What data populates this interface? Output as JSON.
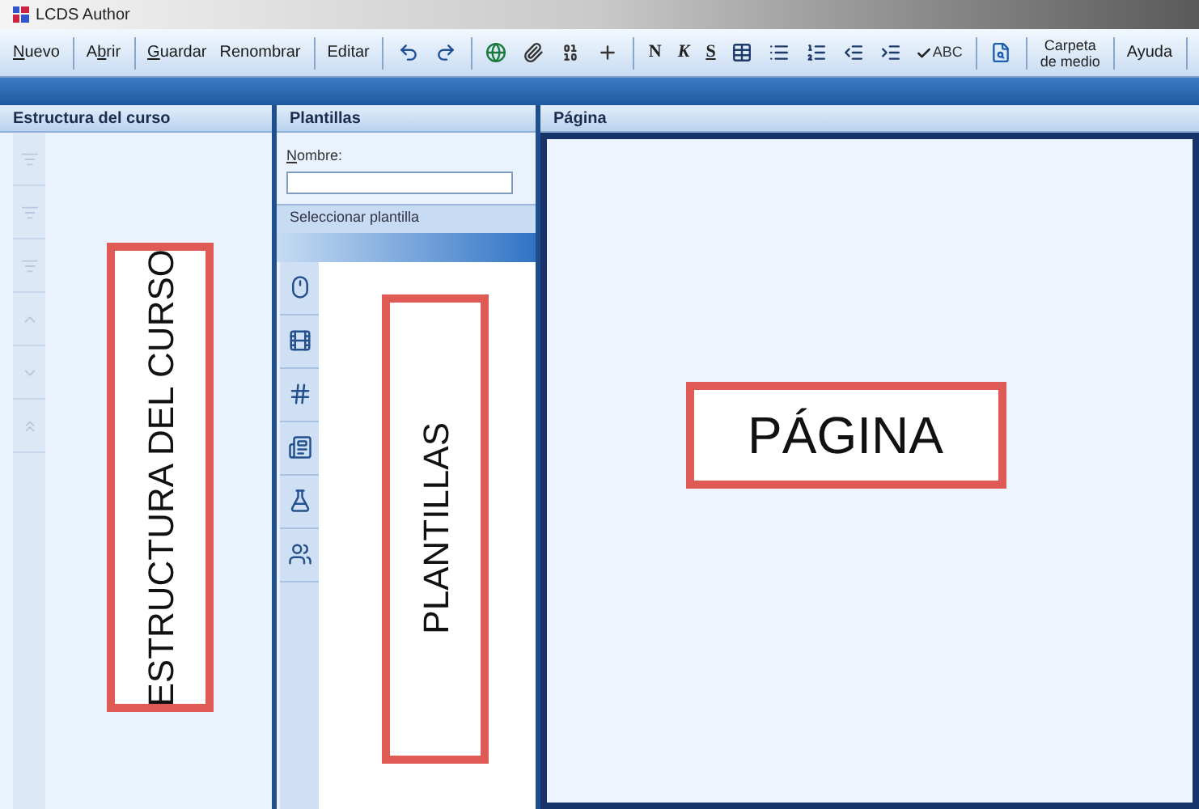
{
  "window": {
    "title": "LCDS Author"
  },
  "toolbar": [
    {
      "kind": "text",
      "key": "N",
      "post": "uevo"
    },
    {
      "kind": "sep"
    },
    {
      "kind": "text",
      "pre": "A",
      "key": "b",
      "post": "rir"
    },
    {
      "kind": "sep"
    },
    {
      "kind": "text",
      "key": "G",
      "post": "uardar"
    },
    {
      "kind": "text",
      "pre": "Renombrar"
    },
    {
      "kind": "sep"
    },
    {
      "kind": "text",
      "pre": "Editar"
    },
    {
      "kind": "sep"
    },
    {
      "kind": "undo"
    },
    {
      "kind": "redo"
    },
    {
      "kind": "sep"
    },
    {
      "kind": "globe"
    },
    {
      "kind": "clip"
    },
    {
      "kind": "binary"
    },
    {
      "kind": "plus"
    },
    {
      "kind": "sep"
    },
    {
      "kind": "bold",
      "label": "N"
    },
    {
      "kind": "italic",
      "label": "K"
    },
    {
      "kind": "underline",
      "label": "S"
    },
    {
      "kind": "table"
    },
    {
      "kind": "list"
    },
    {
      "kind": "numbered"
    },
    {
      "kind": "outdent"
    },
    {
      "kind": "indent"
    },
    {
      "kind": "spell",
      "label": "ABC"
    },
    {
      "kind": "sep"
    },
    {
      "kind": "preview"
    },
    {
      "kind": "sep"
    },
    {
      "kind": "stack",
      "label": "Carpeta",
      "label2": "de medio"
    },
    {
      "kind": "sep"
    },
    {
      "kind": "text",
      "pre": "Ayuda"
    },
    {
      "kind": "sep"
    }
  ],
  "course": {
    "title": "Estructura del curso",
    "strip": [
      {
        "kind": "filter",
        "disabled": true
      },
      {
        "kind": "filter",
        "disabled": true
      },
      {
        "kind": "filter",
        "disabled": true
      },
      {
        "kind": "up",
        "disabled": true
      },
      {
        "kind": "down",
        "disabled": true
      },
      {
        "kind": "top",
        "disabled": true
      }
    ],
    "annotation": "ESTRUCTURA DEL CURSO"
  },
  "templates": {
    "title": "Plantillas",
    "name_label": {
      "key": "N",
      "post": "ombre:"
    },
    "section": "Seleccionar plantilla",
    "categories": [
      {
        "kind": "mouse"
      },
      {
        "kind": "film"
      },
      {
        "kind": "grid"
      },
      {
        "kind": "card"
      },
      {
        "kind": "lab"
      },
      {
        "kind": "people"
      }
    ],
    "annotation": "PLANTILLAS"
  },
  "page": {
    "title": "Página",
    "annotation": "PÁGINA"
  }
}
